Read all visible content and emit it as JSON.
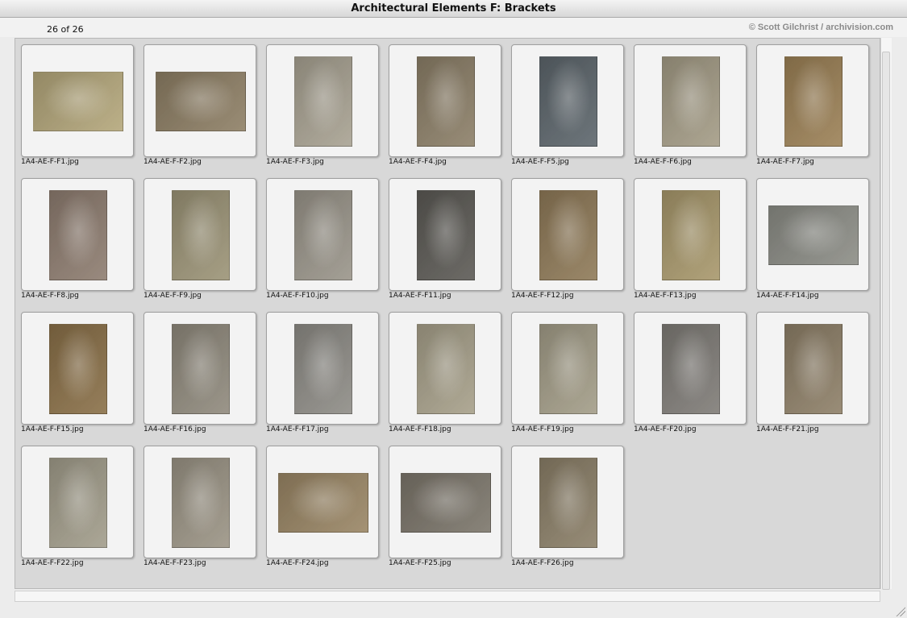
{
  "window": {
    "title": "Architectural Elements F: Brackets"
  },
  "status": {
    "count": "26 of 26",
    "copyright": "© Scott Gilchrist / archivision.com"
  },
  "thumbnails": [
    {
      "filename": "1A4-AE-F-F1.jpg",
      "tone": "#b4a77b",
      "orientation": "landscape"
    },
    {
      "filename": "1A4-AE-F-F2.jpg",
      "tone": "#8e7f65",
      "orientation": "landscape"
    },
    {
      "filename": "1A4-AE-F-F3.jpg",
      "tone": "#a8a292",
      "orientation": "portrait"
    },
    {
      "filename": "1A4-AE-F-F4.jpg",
      "tone": "#8c7f68",
      "orientation": "portrait"
    },
    {
      "filename": "1A4-AE-F-F5.jpg",
      "tone": "#5d666c",
      "orientation": "portrait"
    },
    {
      "filename": "1A4-AE-F-F6.jpg",
      "tone": "#a49c86",
      "orientation": "portrait"
    },
    {
      "filename": "1A4-AE-F-F7.jpg",
      "tone": "#9c8156",
      "orientation": "portrait"
    },
    {
      "filename": "1A4-AE-F-F8.jpg",
      "tone": "#8e7d70",
      "orientation": "portrait"
    },
    {
      "filename": "1A4-AE-F-F9.jpg",
      "tone": "#9c9477",
      "orientation": "portrait"
    },
    {
      "filename": "1A4-AE-F-F10.jpg",
      "tone": "#9a958a",
      "orientation": "portrait"
    },
    {
      "filename": "1A4-AE-F-F11.jpg",
      "tone": "#5c5a55",
      "orientation": "portrait"
    },
    {
      "filename": "1A4-AE-F-F12.jpg",
      "tone": "#8f7a58",
      "orientation": "portrait"
    },
    {
      "filename": "1A4-AE-F-F13.jpg",
      "tone": "#a8986c",
      "orientation": "portrait"
    },
    {
      "filename": "1A4-AE-F-F14.jpg",
      "tone": "#8c8d86",
      "orientation": "landscape"
    },
    {
      "filename": "1A4-AE-F-F15.jpg",
      "tone": "#8a7048",
      "orientation": "portrait"
    },
    {
      "filename": "1A4-AE-F-F16.jpg",
      "tone": "#908a7d",
      "orientation": "portrait"
    },
    {
      "filename": "1A4-AE-F-F17.jpg",
      "tone": "#8e8c86",
      "orientation": "portrait"
    },
    {
      "filename": "1A4-AE-F-F18.jpg",
      "tone": "#a7a08a",
      "orientation": "portrait"
    },
    {
      "filename": "1A4-AE-F-F19.jpg",
      "tone": "#a39d88",
      "orientation": "portrait"
    },
    {
      "filename": "1A4-AE-F-F20.jpg",
      "tone": "#7f7c77",
      "orientation": "portrait"
    },
    {
      "filename": "1A4-AE-F-F21.jpg",
      "tone": "#8e8068",
      "orientation": "portrait"
    },
    {
      "filename": "1A4-AE-F-F22.jpg",
      "tone": "#a29d8b",
      "orientation": "portrait"
    },
    {
      "filename": "1A4-AE-F-F23.jpg",
      "tone": "#9b9485",
      "orientation": "portrait"
    },
    {
      "filename": "1A4-AE-F-F24.jpg",
      "tone": "#9a8665",
      "orientation": "landscape"
    },
    {
      "filename": "1A4-AE-F-F25.jpg",
      "tone": "#7c766b",
      "orientation": "landscape"
    },
    {
      "filename": "1A4-AE-F-F26.jpg",
      "tone": "#8b7f68",
      "orientation": "portrait"
    }
  ]
}
